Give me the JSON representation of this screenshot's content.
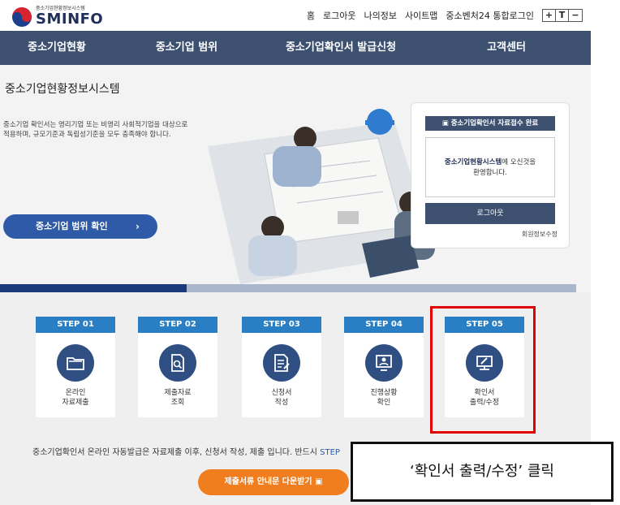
{
  "header": {
    "logo_sub": "중소기업현황정보시스템",
    "logo_name": "SMINFO",
    "links": [
      "홈",
      "로그아웃",
      "나의정보",
      "사이트맵",
      "중소벤처24 통합로그인"
    ],
    "font_controls": [
      "+",
      "T",
      "−"
    ]
  },
  "nav": {
    "items": [
      "중소기업현황",
      "중소기업 범위",
      "중소기업확인서 발급신청",
      "고객센터"
    ]
  },
  "hero": {
    "title": "중소기업현황정보시스템",
    "description": "중소기업 확인서는 영리기업 또는 비영리 사회적기업을 대상으로 적용하며, 규모기준과 독립성기준을 모두 충족해야 합니다.",
    "button_label": "중소기업 범위 확인",
    "button_arrow": "›"
  },
  "login_panel": {
    "head": "중소기업확인서 자료접수 완료",
    "welcome_bold": "중소기업현황시스템",
    "welcome_rest": "에 오신것을",
    "welcome_line2": "환영합니다.",
    "logout_label": "로그아웃",
    "edit_label": "회원정보수정"
  },
  "steps": [
    {
      "label": "STEP 01",
      "line1": "온라인",
      "line2": "자료제출",
      "icon": "folder-icon"
    },
    {
      "label": "STEP 02",
      "line1": "제출자료",
      "line2": "조회",
      "icon": "document-search-icon"
    },
    {
      "label": "STEP 03",
      "line1": "신청서",
      "line2": "작성",
      "icon": "document-edit-icon"
    },
    {
      "label": "STEP 04",
      "line1": "진행상황",
      "line2": "확인",
      "icon": "person-screen-icon"
    },
    {
      "label": "STEP 05",
      "line1": "확인서",
      "line2": "출력/수정",
      "icon": "monitor-edit-icon"
    }
  ],
  "notice": {
    "text": "중소기업확인서 온라인 자동발급은 자료제출 이후, 신청서 작성, 제출 입니다. 반드시 ",
    "highlight": "STEP"
  },
  "download_button": "제출서류 안내문 다운받기",
  "callout": "‘확인서 출력/수정’ 클릭",
  "colors": {
    "nav_bg": "#3d506f",
    "step_label": "#2a7ec4",
    "step_icon_bg": "#2f4e82",
    "hero_button": "#2f5aa8",
    "download_button": "#f07d1e",
    "highlight_border": "#e00000"
  }
}
